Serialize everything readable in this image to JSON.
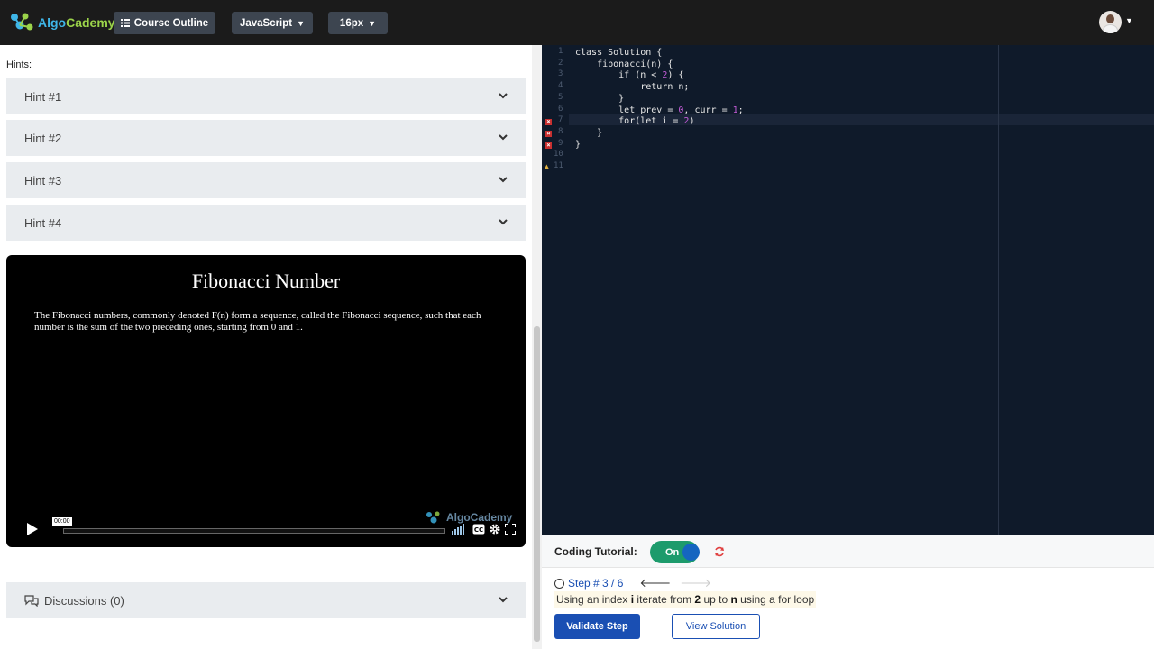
{
  "app": {
    "logo_prefix": "Algo",
    "logo_suffix": "Cademy"
  },
  "toolbar": {
    "course_outline": "Course Outline",
    "language": "JavaScript",
    "font_size": "16px"
  },
  "hints": {
    "label": "Hints:",
    "items": [
      "Hint #1",
      "Hint #2",
      "Hint #3",
      "Hint #4"
    ]
  },
  "video": {
    "title": "Fibonacci Number",
    "text": "The Fibonacci numbers, commonly denoted F(n) form a sequence, called the Fibonacci sequence, such that each number is the sum of the two preceding ones, starting from 0 and 1.",
    "time": "00:00",
    "progress": 0,
    "watermark": "AlgoCademy"
  },
  "discussions": {
    "label": "Discussions (0)"
  },
  "editor": {
    "lines": [
      {
        "num": "1",
        "code": "class Solution {"
      },
      {
        "num": "2",
        "code": "    fibonacci(n) {"
      },
      {
        "num": "3",
        "code": "        if (n < 2) {"
      },
      {
        "num": "4",
        "code": "            return n;"
      },
      {
        "num": "5",
        "code": "        }"
      },
      {
        "num": "6",
        "code": "        let prev = 0, curr = 1;"
      },
      {
        "num": "7",
        "code": "        for(let i = 2)"
      },
      {
        "num": "8",
        "code": "    }"
      },
      {
        "num": "9",
        "code": "}"
      },
      {
        "num": "10",
        "code": ""
      },
      {
        "num": "11",
        "code": ""
      }
    ],
    "error_lines": [
      7,
      8,
      9
    ],
    "warning_lines": [
      11
    ],
    "active_line": 7
  },
  "tutorial": {
    "label": "Coding Tutorial:",
    "toggle": "On",
    "step": "Step # 3 / 6",
    "instruction_pre": "Using an index ",
    "instruction_i": "i",
    "instruction_mid": " iterate from ",
    "instruction_2": "2",
    "instruction_upto": " up to ",
    "instruction_n": "n",
    "instruction_post": " using a for loop",
    "validate": "Validate Step",
    "view_solution": "View Solution"
  },
  "colors": {
    "topbar": "#1b1b1b",
    "editor_bg": "#0f1a2a",
    "accent_blue": "#1a4fb3",
    "toggle_green": "#1d9b6c",
    "error_red": "#c83030"
  }
}
